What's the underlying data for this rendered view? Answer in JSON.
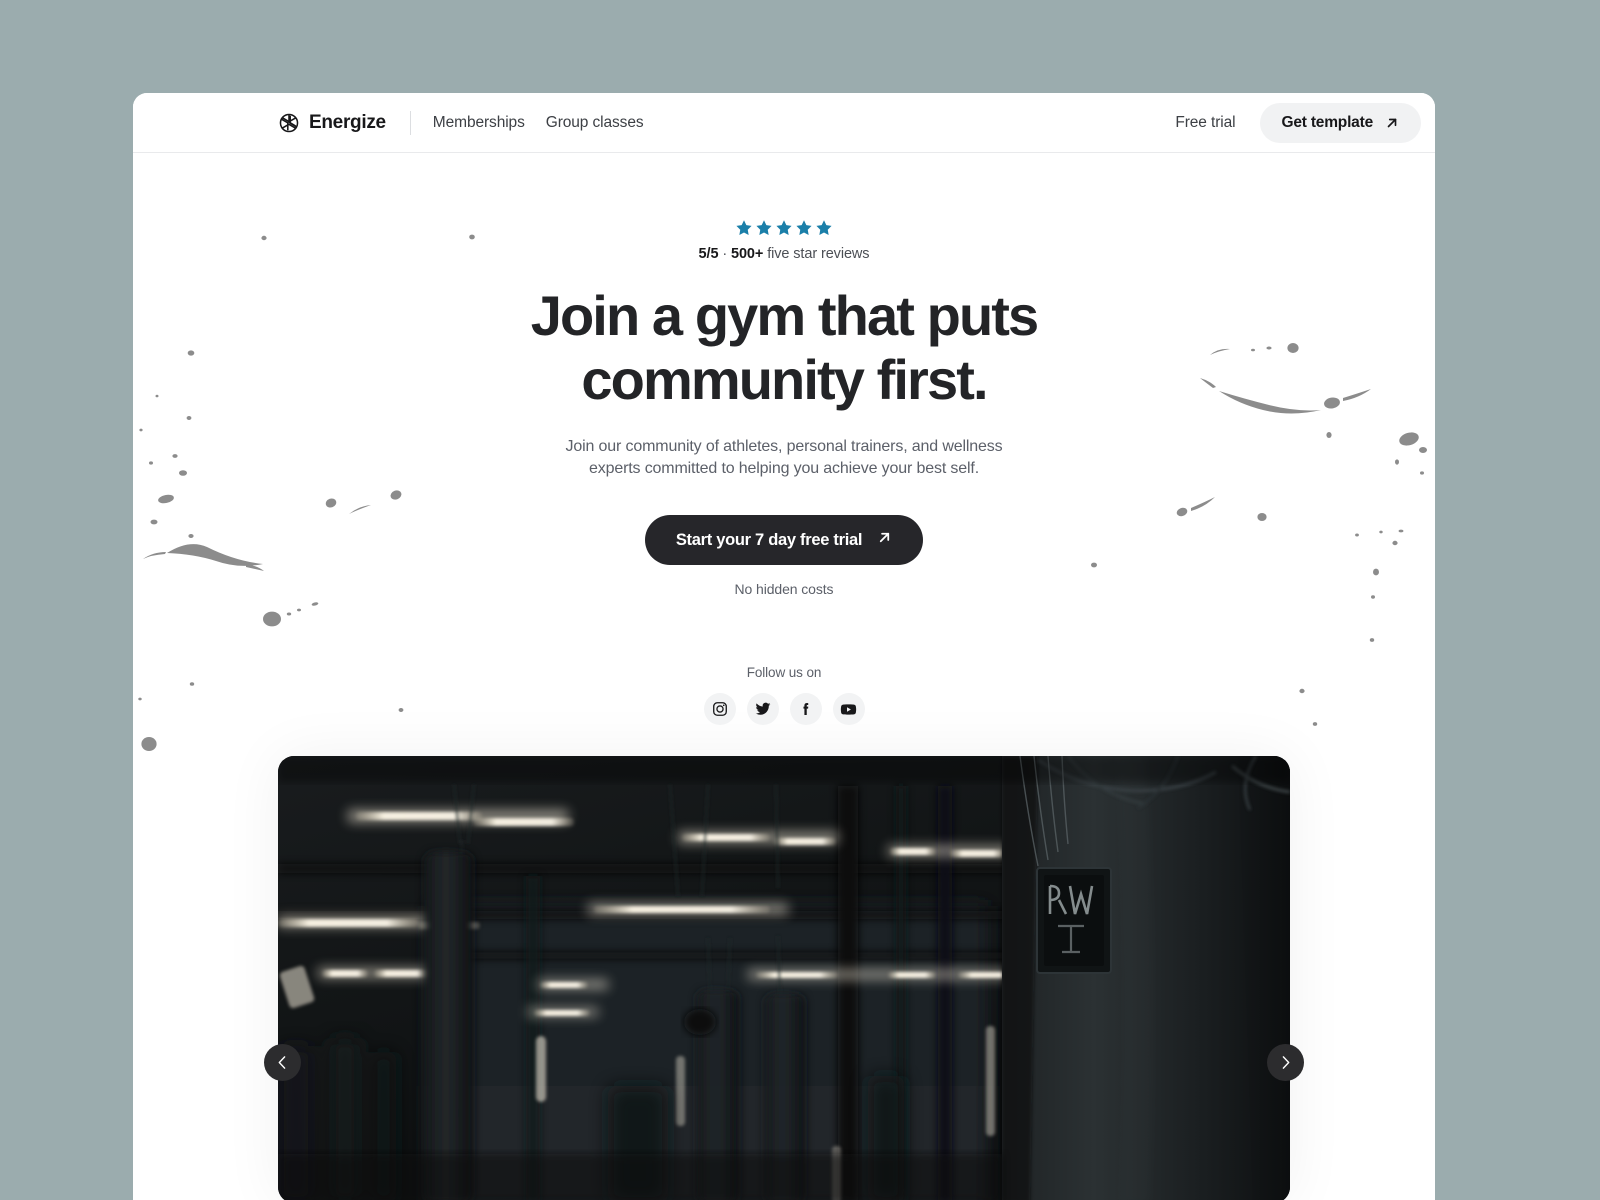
{
  "theme": {
    "page_background": "#9BACAE",
    "card_background": "#FFFFFF",
    "accent_star": "#1B7FA9",
    "cta_background": "#26262A",
    "text_dark": "#232427",
    "text_muted": "#5C6069",
    "splatter": "#8C8C8C"
  },
  "nav": {
    "brand": {
      "name": "Energize",
      "icon": "aperture-icon"
    },
    "links": [
      {
        "label": "Memberships"
      },
      {
        "label": "Group classes"
      }
    ],
    "free_trial_label": "Free trial",
    "template_button": {
      "label": "Get template",
      "icon": "arrow-up-right-icon"
    }
  },
  "hero": {
    "rating": {
      "stars": 5,
      "score": "5/5",
      "separator": " · ",
      "count": "500+",
      "suffix": " five star reviews",
      "full_text": "5/5 · 500+ five star reviews"
    },
    "headline": "Join a gym that puts community first.",
    "subheadline": "Join our community of athletes, personal trainers, and wellness experts committed to helping you achieve your best self.",
    "cta": {
      "label": "Start your 7 day free trial",
      "icon": "arrow-up-right-icon"
    },
    "cta_note": "No hidden costs"
  },
  "social": {
    "label": "Follow us on",
    "items": [
      {
        "name": "instagram",
        "icon": "instagram-icon"
      },
      {
        "name": "twitter",
        "icon": "twitter-icon"
      },
      {
        "name": "facebook",
        "icon": "facebook-icon"
      },
      {
        "name": "youtube",
        "icon": "youtube-icon"
      }
    ]
  },
  "carousel": {
    "prev_icon": "chevron-left-icon",
    "next_icon": "chevron-right-icon",
    "slide_description": "Dark boxing gym interior with hanging punching bags and fluorescent tube lights"
  }
}
